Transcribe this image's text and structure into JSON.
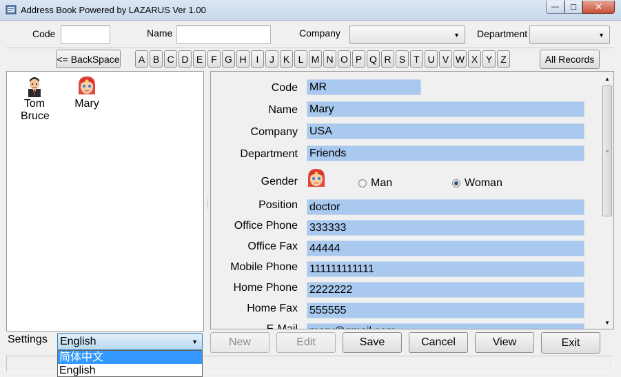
{
  "window": {
    "title": "Address Book Powered by LAZARUS  Ver 1.00",
    "controls": {
      "minimize": "—",
      "maximize": "☐",
      "close": "✕"
    }
  },
  "search": {
    "code_label": "Code",
    "code_value": "",
    "name_label": "Name",
    "name_value": "",
    "company_label": "Company",
    "company_value": "",
    "department_label": "Department",
    "department_value": ""
  },
  "alphabet": {
    "backspace": "<= BackSpace",
    "letters": [
      "A",
      "B",
      "C",
      "D",
      "E",
      "F",
      "G",
      "H",
      "I",
      "J",
      "K",
      "L",
      "M",
      "N",
      "O",
      "P",
      "Q",
      "R",
      "S",
      "T",
      "U",
      "V",
      "W",
      "X",
      "Y",
      "Z"
    ],
    "all_records": "All Records"
  },
  "contacts": [
    {
      "name": "Tom Bruce",
      "icon": "man-avatar-icon"
    },
    {
      "name": "Mary",
      "icon": "woman-avatar-icon"
    }
  ],
  "detail": {
    "code": {
      "label": "Code",
      "value": "MR"
    },
    "name": {
      "label": "Name",
      "value": "Mary"
    },
    "company": {
      "label": "Company",
      "value": "USA"
    },
    "department": {
      "label": "Department",
      "value": "Friends"
    },
    "gender": {
      "label": "Gender",
      "options": [
        "Man",
        "Woman"
      ],
      "selected": "Woman"
    },
    "position": {
      "label": "Position",
      "value": "doctor"
    },
    "office_phone": {
      "label": "Office Phone",
      "value": "333333"
    },
    "office_fax": {
      "label": "Office Fax",
      "value": "44444"
    },
    "mobile_phone": {
      "label": "Mobile Phone",
      "value": "111111111111"
    },
    "home_phone": {
      "label": "Home Phone",
      "value": "2222222"
    },
    "home_fax": {
      "label": "Home Fax",
      "value": "555555"
    },
    "email": {
      "label": "E-Mail",
      "value": "mary@gmail.com"
    }
  },
  "settings": {
    "label": "Settings",
    "language_selected": "English",
    "language_options": [
      "简体中文",
      "English"
    ]
  },
  "actions": {
    "new": "New",
    "edit": "Edit",
    "save": "Save",
    "cancel": "Cancel",
    "view": "View",
    "exit": "Exit"
  },
  "colors": {
    "field_fill": "#a9c9ef",
    "selection": "#3399ff"
  }
}
